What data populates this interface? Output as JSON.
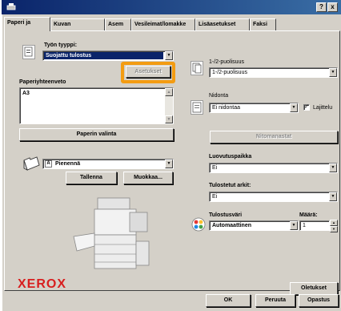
{
  "titlebar": {
    "help_glyph": "?",
    "close_glyph": "x",
    "app_icon": "printer-app-icon"
  },
  "tabs": [
    {
      "label": "Paperi ja"
    },
    {
      "label": "Kuvan"
    },
    {
      "label": "Asem"
    },
    {
      "label": "Vesileimat/lomakke"
    },
    {
      "label": "Lisäasetukset"
    },
    {
      "label": "Faksi"
    }
  ],
  "left": {
    "job_type_label": "Työn tyyppi:",
    "job_type_value": "Suojattu tulostus",
    "settings_button": "Asetukset",
    "paper_summary_label": "Paperiyhteenveto",
    "paper_summary_value": "A3",
    "paper_select_button": "Paperin valinta",
    "reduce_value": "Pienennä",
    "save_button": "Tallenna",
    "edit_button": "Muokkaa...",
    "brand": "XEROX"
  },
  "right": {
    "duplex_label": "1-/2-puolisuus",
    "duplex_value": "1-/2-puolisuus",
    "stapling_label": "Nidonta",
    "stapling_value": "Ei nidontaa",
    "collate_label": "Lajittelu",
    "collate_glyph": "✓",
    "stapling_options_button": "Nitomanastat",
    "output_label": "Luovutuspaikka",
    "output_value": "Ei",
    "printed_sheets_label": "Tulostetut arkit:",
    "printed_sheets_value": "Ei",
    "color_label": "Tulostusväri",
    "color_value": "Automaattinen",
    "quantity_label": "Määrä:",
    "quantity_value": "1",
    "defaults_button": "Oletukset"
  },
  "footer": {
    "ok_button": "OK",
    "cancel_button": "Peruuta",
    "help_button": "Opastus"
  },
  "colors": {
    "highlight": "#f39c12",
    "selection": "#0a246a",
    "brand": "#d81e1e"
  }
}
